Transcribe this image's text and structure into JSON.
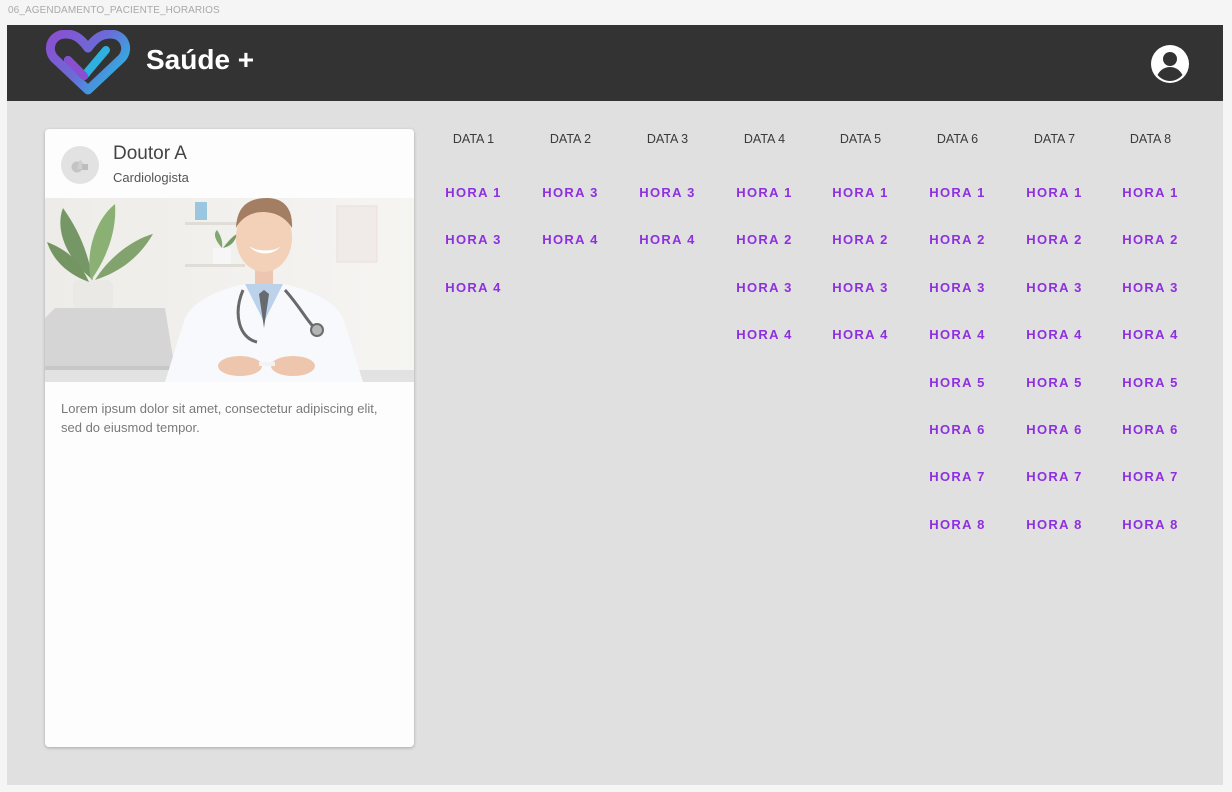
{
  "frame": {
    "label": "06_AGENDAMENTO_PACIENTE_HORARIOS"
  },
  "appbar": {
    "brand": "Saúde +",
    "logo_icon": "heart-check-logo",
    "account_icon": "account-circle-icon"
  },
  "doctor_card": {
    "name": "Doutor A",
    "specialty": "Cardiologista",
    "avatar_icon": "avatar-placeholder-icon",
    "photo": "doctor-photo",
    "description": "Lorem ipsum dolor sit amet, consectetur adipiscing elit, sed do eiusmod tempor."
  },
  "schedule": {
    "columns": [
      {
        "date": "DATA 1",
        "times": [
          "HORA 1",
          "HORA 3",
          "HORA 4"
        ]
      },
      {
        "date": "DATA 2",
        "times": [
          "HORA 3",
          "HORA 4"
        ]
      },
      {
        "date": "DATA 3",
        "times": [
          "HORA 3",
          "HORA 4"
        ]
      },
      {
        "date": "DATA 4",
        "times": [
          "HORA 1",
          "HORA 2",
          "HORA 3",
          "HORA 4"
        ]
      },
      {
        "date": "DATA 5",
        "times": [
          "HORA 1",
          "HORA 2",
          "HORA 3",
          "HORA 4"
        ]
      },
      {
        "date": "DATA 6",
        "times": [
          "HORA 1",
          "HORA 2",
          "HORA 3",
          "HORA 4",
          "HORA 5",
          "HORA 6",
          "HORA 7",
          "HORA 8"
        ]
      },
      {
        "date": "DATA 7",
        "times": [
          "HORA 1",
          "HORA 2",
          "HORA 3",
          "HORA 4",
          "HORA 5",
          "HORA 6",
          "HORA 7",
          "HORA 8"
        ]
      },
      {
        "date": "DATA 8",
        "times": [
          "HORA 1",
          "HORA 2",
          "HORA 3",
          "HORA 4",
          "HORA 5",
          "HORA 6",
          "HORA 7",
          "HORA 8"
        ]
      }
    ]
  },
  "colors": {
    "appbar": "#333333",
    "background": "#e0e0e0",
    "accent": "#8e2fe0",
    "logo_purple": "#8a4fd0",
    "logo_blue": "#2eb0e0"
  }
}
